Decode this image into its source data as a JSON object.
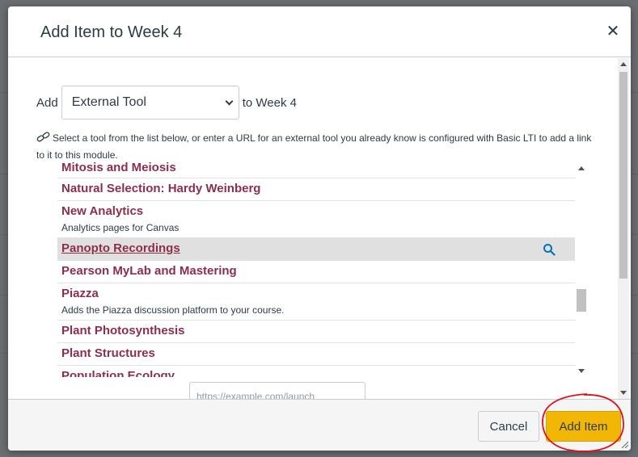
{
  "dialog": {
    "title": "Add Item to Week 4",
    "close_icon": "close-icon"
  },
  "add_row": {
    "prefix": "Add",
    "selected_type": "External Tool",
    "suffix": "to Week 4"
  },
  "description": "Select a tool from the list below, or enter a URL for an external tool you already know is configured with Basic LTI to add a link to it to this module.",
  "tools": [
    {
      "name": "Mitosis and Meiosis",
      "desc": ""
    },
    {
      "name": "Natural Selection: Hardy Weinberg",
      "desc": ""
    },
    {
      "name": "New Analytics",
      "desc": "Analytics pages for Canvas"
    },
    {
      "name": "Panopto Recordings",
      "desc": "",
      "selected": true
    },
    {
      "name": "Pearson MyLab and Mastering",
      "desc": ""
    },
    {
      "name": "Piazza",
      "desc": "Adds the Piazza discussion platform to your course."
    },
    {
      "name": "Plant Photosynthesis",
      "desc": ""
    },
    {
      "name": "Plant Structures",
      "desc": ""
    },
    {
      "name": "Population Ecology",
      "desc": ""
    }
  ],
  "url_field": {
    "placeholder": "https://example.com/launch"
  },
  "footer": {
    "cancel_label": "Cancel",
    "add_item_label": "Add Item"
  },
  "colors": {
    "tool_name": "#8b2f4b",
    "primary_button": "#f2b705",
    "annotation": "#e0101a"
  }
}
